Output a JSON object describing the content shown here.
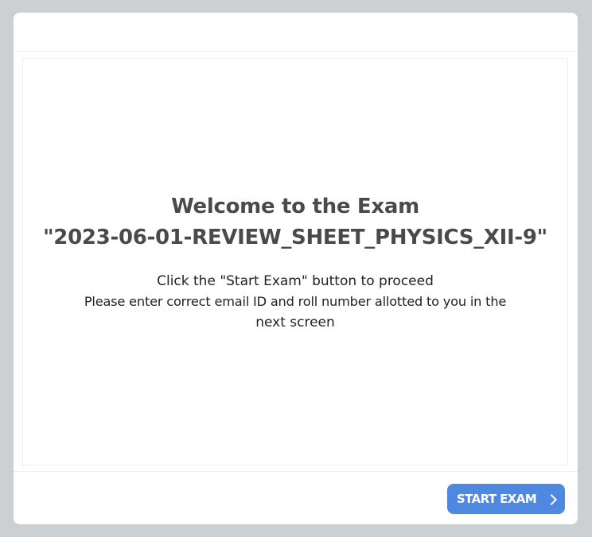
{
  "welcome": {
    "title_line1": "Welcome to the Exam",
    "title_line2": "\"2023-06-01-REVIEW_SHEET_PHYSICS_XII-9\"",
    "instruction_line1": "Click the \"Start Exam\" button to proceed",
    "instruction_line2": "Please enter correct email ID and roll number allotted to you in the",
    "instruction_line3": "next screen"
  },
  "footer": {
    "start_button_label": "START EXAM",
    "start_button_icon": "chevron-right-icon"
  },
  "colors": {
    "page_background": "#cdd0d3",
    "button_background": "#4f88e0"
  }
}
